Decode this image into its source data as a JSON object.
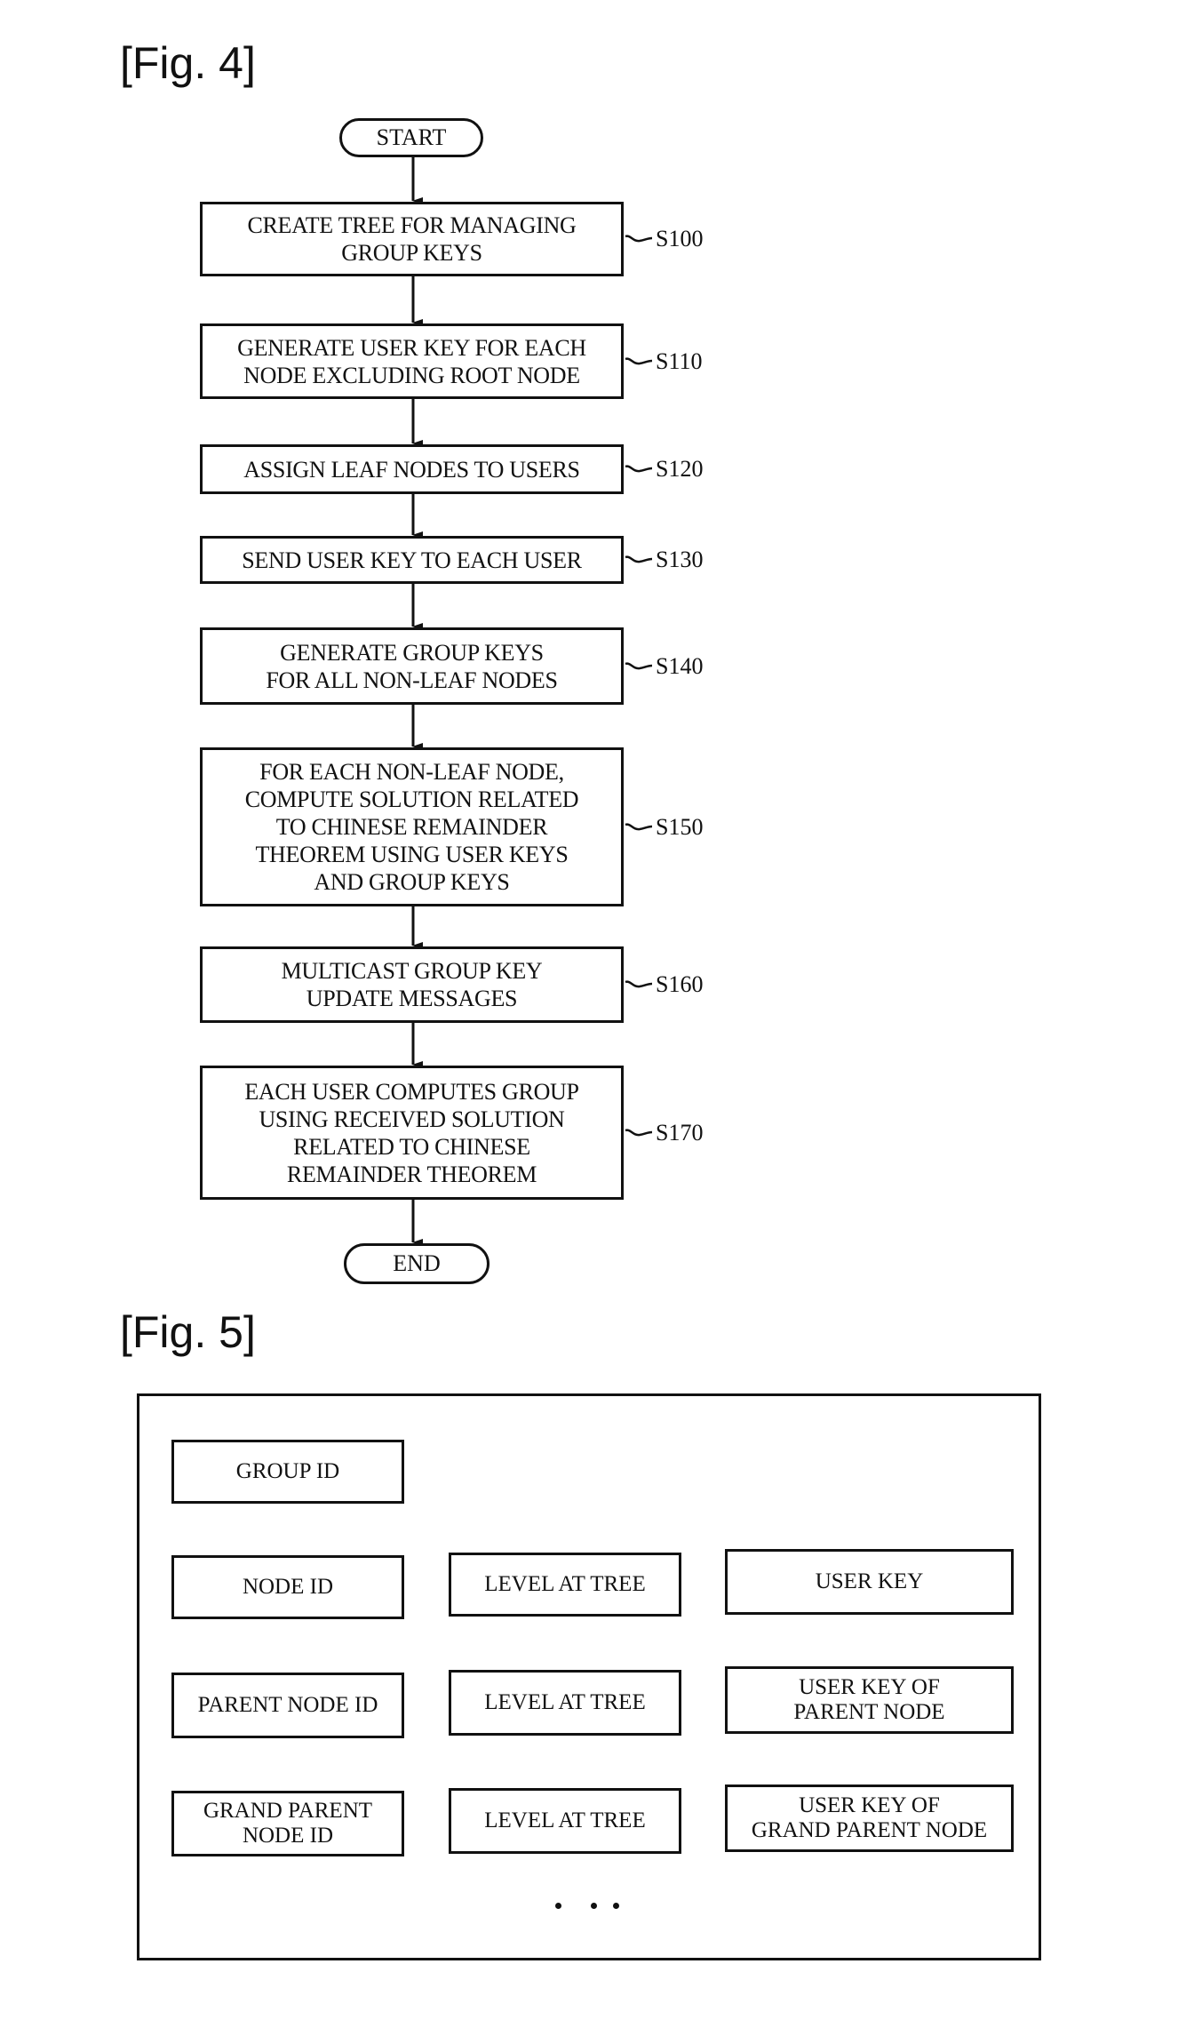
{
  "fig4": {
    "label": "[Fig. 4]",
    "start": "START",
    "end": "END",
    "steps": [
      {
        "id": "S100",
        "text": "CREATE TREE FOR MANAGING\nGROUP KEYS"
      },
      {
        "id": "S110",
        "text": "GENERATE USER KEY FOR EACH\nNODE EXCLUDING ROOT NODE"
      },
      {
        "id": "S120",
        "text": "ASSIGN LEAF NODES TO USERS"
      },
      {
        "id": "S130",
        "text": "SEND USER KEY TO EACH USER"
      },
      {
        "id": "S140",
        "text": "GENERATE GROUP KEYS\nFOR ALL NON-LEAF NODES"
      },
      {
        "id": "S150",
        "text": "FOR EACH NON-LEAF NODE,\nCOMPUTE SOLUTION RELATED\nTO CHINESE REMAINDER\nTHEOREM USING USER KEYS\nAND GROUP KEYS"
      },
      {
        "id": "S160",
        "text": "MULTICAST GROUP KEY\nUPDATE MESSAGES"
      },
      {
        "id": "S170",
        "text": "EACH USER COMPUTES GROUP\nUSING RECEIVED SOLUTION\nRELATED TO CHINESE\nREMAINDER THEOREM"
      }
    ]
  },
  "fig5": {
    "label": "[Fig. 5]",
    "group_id": "GROUP ID",
    "rows": [
      {
        "id": "NODE ID",
        "level": "LEVEL AT TREE",
        "key": "USER KEY"
      },
      {
        "id": "PARENT NODE ID",
        "level": "LEVEL AT TREE",
        "key": "USER KEY OF\nPARENT NODE"
      },
      {
        "id": "GRAND PARENT\nNODE ID",
        "level": "LEVEL AT TREE",
        "key": "USER KEY OF\nGRAND PARENT NODE"
      }
    ],
    "continuation": "..."
  }
}
